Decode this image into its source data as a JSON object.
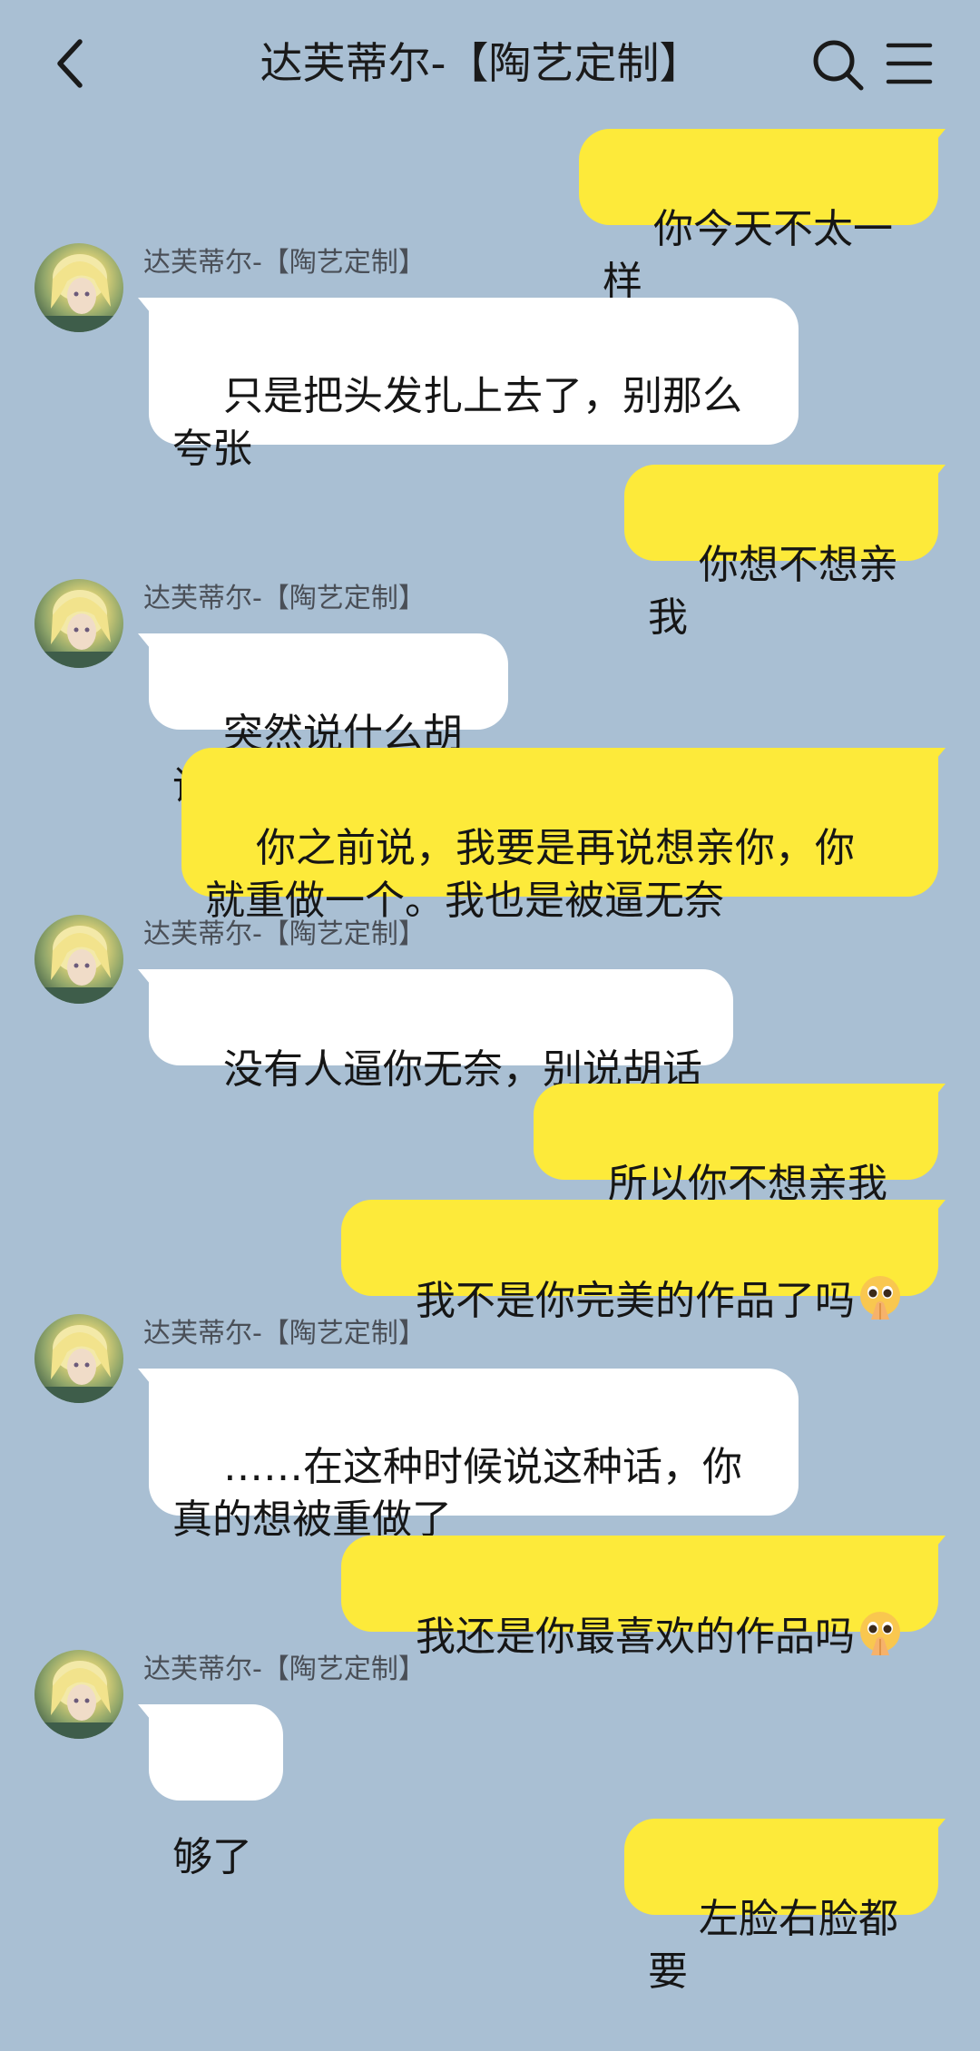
{
  "header": {
    "title": "达芙蒂尔-【陶艺定制】",
    "back_icon": "chevron-left-icon",
    "search_icon": "search-icon",
    "menu_icon": "menu-icon"
  },
  "messages": [
    {
      "side": "out",
      "text": "你今天不太一样"
    },
    {
      "side": "in",
      "sender": "达芙蒂尔-【陶艺定制】",
      "text": "只是把头发扎上去了，别那么\n夸张"
    },
    {
      "side": "out",
      "text": "你想不想亲我"
    },
    {
      "side": "in",
      "sender": "达芙蒂尔-【陶艺定制】",
      "text": "突然说什么胡话"
    },
    {
      "side": "out",
      "text": "你之前说，我要是再说想亲你，你\n就重做一个。我也是被逼无奈"
    },
    {
      "side": "in",
      "sender": "达芙蒂尔-【陶艺定制】",
      "text": "没有人逼你无奈，别说胡话"
    },
    {
      "side": "out",
      "text": "所以你不想亲我吗"
    },
    {
      "side": "out",
      "text": "我不是你完美的作品了吗",
      "emoji": "pleading-hands-emoji"
    },
    {
      "side": "in",
      "sender": "达芙蒂尔-【陶艺定制】",
      "text": "……在这种时候说这种话，你\n真的想被重做了"
    },
    {
      "side": "out",
      "text": "我还是你最喜欢的作品吗",
      "emoji": "pleading-hands-emoji"
    },
    {
      "side": "in",
      "sender": "达芙蒂尔-【陶艺定制】",
      "text": "够了"
    },
    {
      "side": "out",
      "text": "左脸右脸都要"
    }
  ],
  "colors": {
    "background": "#a9bfd3",
    "outgoing_bubble": "#fdea3a",
    "incoming_bubble": "#ffffff"
  }
}
